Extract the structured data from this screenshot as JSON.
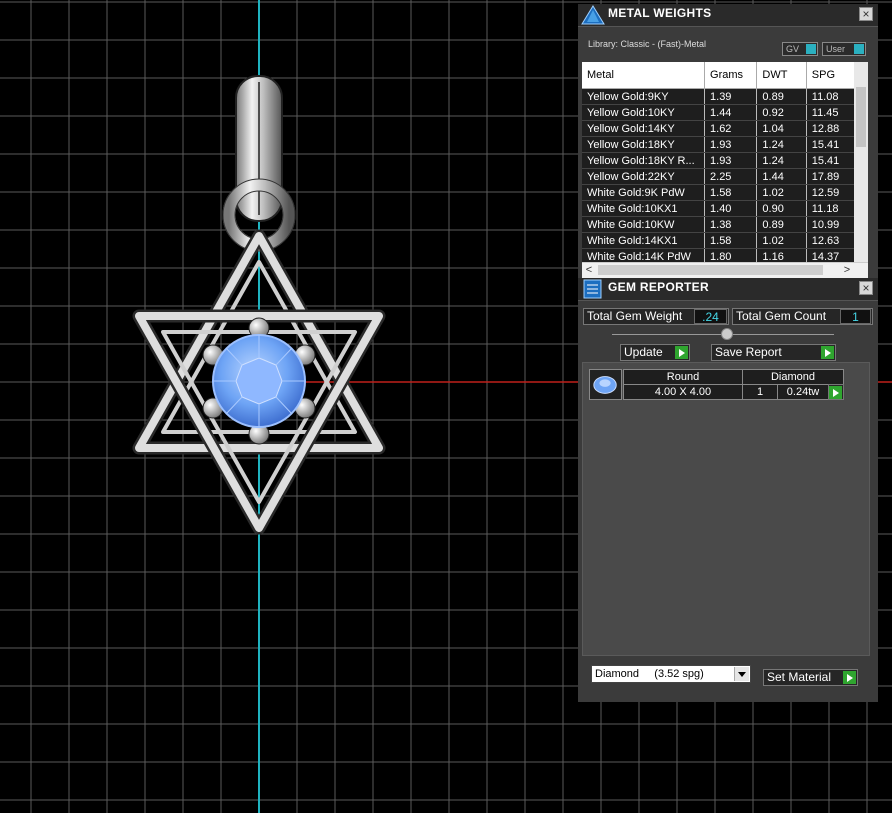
{
  "metal_weights": {
    "title": "METAL WEIGHTS",
    "library_label": "Library: Classic - (Fast)-Metal",
    "toggle_gv": "GV",
    "toggle_user": "User",
    "close_glyph": "×",
    "columns": [
      "Metal",
      "Grams",
      "DWT",
      "SPG"
    ],
    "rows": [
      [
        "Yellow Gold:9KY",
        "1.39",
        "0.89",
        "11.08"
      ],
      [
        "Yellow Gold:10KY",
        "1.44",
        "0.92",
        "11.45"
      ],
      [
        "Yellow Gold:14KY",
        "1.62",
        "1.04",
        "12.88"
      ],
      [
        "Yellow Gold:18KY",
        "1.93",
        "1.24",
        "15.41"
      ],
      [
        "Yellow Gold:18KY R...",
        "1.93",
        "1.24",
        "15.41"
      ],
      [
        "Yellow Gold:22KY",
        "2.25",
        "1.44",
        "17.89"
      ],
      [
        "White Gold:9K PdW",
        "1.58",
        "1.02",
        "12.59"
      ],
      [
        "White Gold:10KX1",
        "1.40",
        "0.90",
        "11.18"
      ],
      [
        "White Gold:10KW",
        "1.38",
        "0.89",
        "10.99"
      ],
      [
        "White Gold:14KX1",
        "1.58",
        "1.02",
        "12.63"
      ],
      [
        "White Gold:14K PdW",
        "1.80",
        "1.16",
        "14.37"
      ]
    ],
    "scroll_left": "<",
    "scroll_right": ">"
  },
  "gem_reporter": {
    "title": "GEM REPORTER",
    "close_glyph": "×",
    "total_weight_label": "Total Gem Weight",
    "total_weight_value": ".24",
    "total_count_label": "Total Gem Count",
    "total_count_value": "1",
    "update_label": "Update",
    "save_label": "Save Report",
    "gem": {
      "shape": "Round",
      "material": "Diamond",
      "size": "4.00 X 4.00",
      "count": "1",
      "weight": "0.24tw"
    },
    "material_select": "Diamond     (3.52 spg)",
    "set_material_label": "Set Material"
  },
  "colors": {
    "background": "#000000",
    "grid": "#5a5a5a",
    "axis_vertical": "#1fb3c0",
    "axis_horizontal": "#c0201a",
    "accent": "#45d6e6",
    "go_button": "#2fa52f",
    "gem": "#6ea4f5"
  },
  "icons": {
    "metal_panel": "pyramid-logo-icon",
    "gem_panel": "gem-report-icon",
    "close": "close-icon",
    "go": "play-arrow-icon",
    "dropdown": "chevron-down-icon"
  }
}
